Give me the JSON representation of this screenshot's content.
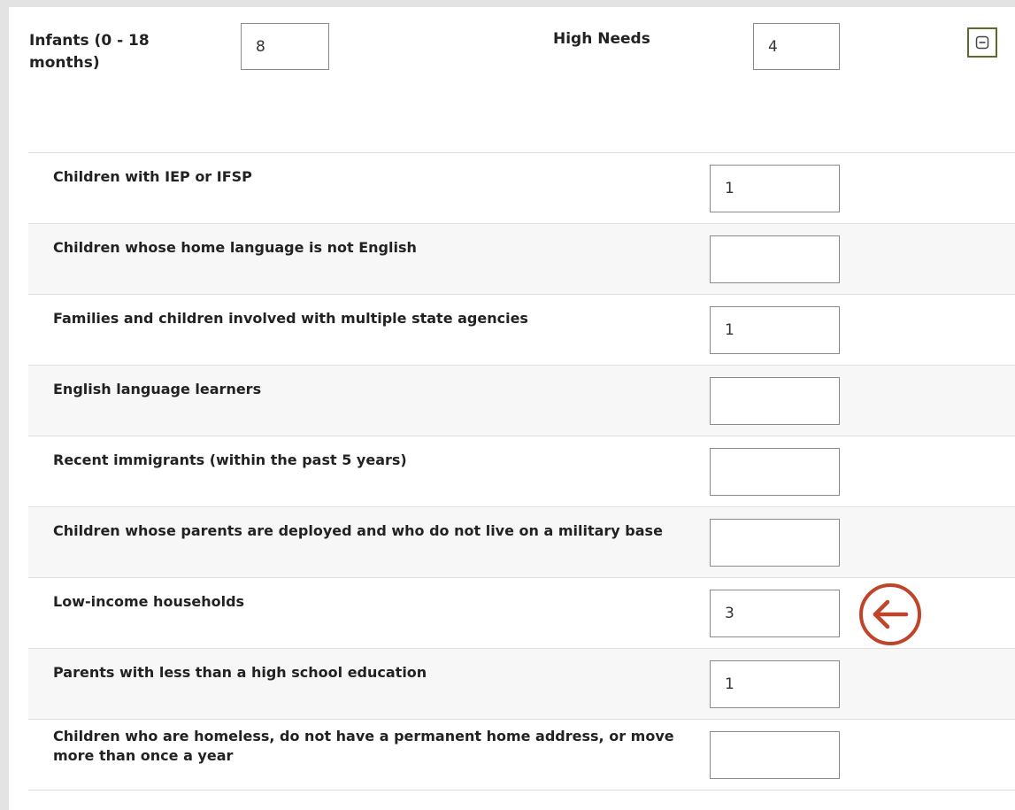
{
  "header": {
    "infants_label": "Infants (0 - 18 months)",
    "infants_value": "8",
    "high_needs_label": "High Needs",
    "high_needs_value": "4"
  },
  "collapse_icon": "minus-in-square-icon",
  "callout": {
    "icon": "arrow-left-circle-icon",
    "color": "#c0442a"
  },
  "colors": {
    "border": "#8a8a8a",
    "row_divider": "#dedede",
    "alt_row": "#f7f7f7",
    "collapse_border": "#5b6b2a"
  },
  "rows": [
    {
      "label": "Children with IEP or IFSP",
      "value": "1"
    },
    {
      "label": "Children whose home language is not English",
      "value": ""
    },
    {
      "label": "Families and children involved with multiple state agencies",
      "value": "1"
    },
    {
      "label": "English language learners",
      "value": ""
    },
    {
      "label": "Recent immigrants (within the past 5 years)",
      "value": ""
    },
    {
      "label": "Children whose parents are deployed and who do not live on a military base",
      "value": ""
    },
    {
      "label": "Low-income households",
      "value": "3"
    },
    {
      "label": "Parents with less than a high school education",
      "value": "1"
    },
    {
      "label": "Children who are homeless, do not have a permanent home address, or move more than once a year",
      "value": ""
    }
  ]
}
